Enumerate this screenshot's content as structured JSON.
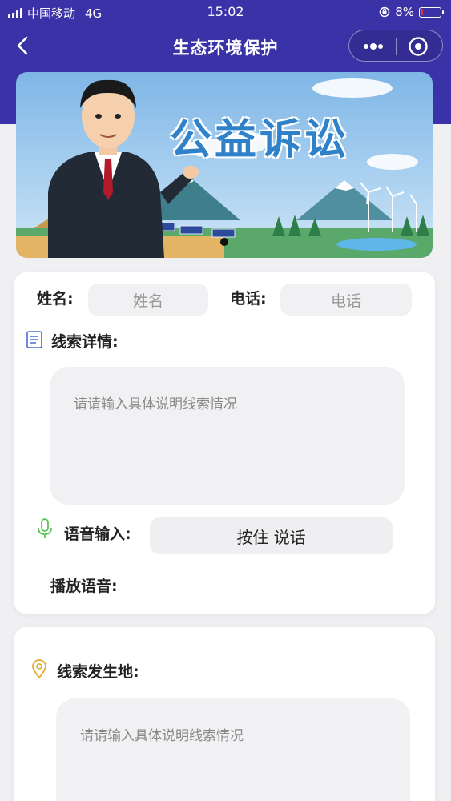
{
  "status_bar": {
    "carrier": "中国移动",
    "network": "4G",
    "time": "15:02",
    "battery": "8%"
  },
  "nav": {
    "title": "生态环境保护"
  },
  "banner": {
    "title": "公益诉讼"
  },
  "form": {
    "name_label": "姓名:",
    "name_placeholder": "姓名",
    "phone_label": "电话:",
    "phone_placeholder": "电话",
    "details_label": "线索详情:",
    "details_placeholder": "请请输入具体说明线索情况",
    "voice_label": "语音输入:",
    "voice_button": "按住 说话",
    "playback_label": "播放语音:",
    "location_label": "线索发生地:",
    "location_placeholder": "请请输入具体说明线索情况"
  },
  "colors": {
    "header": "#3a33a8",
    "page_bg": "#f0f0f3",
    "mic_icon": "#5cc35a",
    "location_icon": "#e6a826",
    "list_icon": "#4a6bd6"
  }
}
